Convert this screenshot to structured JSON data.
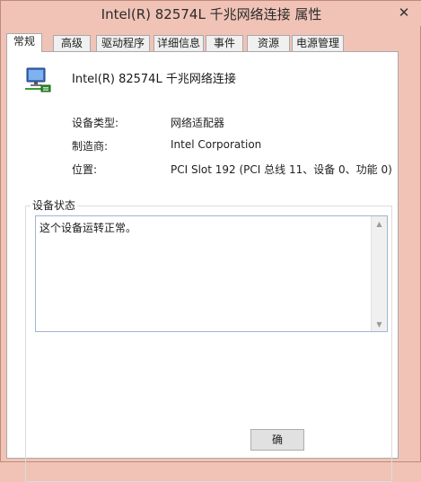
{
  "window": {
    "title": "Intel(R) 82574L 千兆网络连接 属性",
    "close_glyph": "✕"
  },
  "tabs": [
    {
      "label": "常规",
      "active": true
    },
    {
      "label": "高级"
    },
    {
      "label": "驱动程序"
    },
    {
      "label": "详细信息"
    },
    {
      "label": "事件"
    },
    {
      "label": "资源"
    },
    {
      "label": "电源管理"
    }
  ],
  "device": {
    "icon": "network-adapter-icon",
    "name": "Intel(R) 82574L 千兆网络连接"
  },
  "properties": [
    {
      "label": "设备类型:",
      "value": "网络适配器"
    },
    {
      "label": "制造商:",
      "value": "Intel Corporation"
    },
    {
      "label": "位置:",
      "value": "PCI Slot 192 (PCI 总线 11、设备 0、功能 0)"
    }
  ],
  "status_group": {
    "title": "设备状态",
    "text": "这个设备运转正常。"
  },
  "buttons": {
    "ok_label": "确"
  },
  "colors": {
    "window_frame": "#f0c3b6",
    "panel": "#ffffff",
    "status_border": "#9fb5d2"
  }
}
